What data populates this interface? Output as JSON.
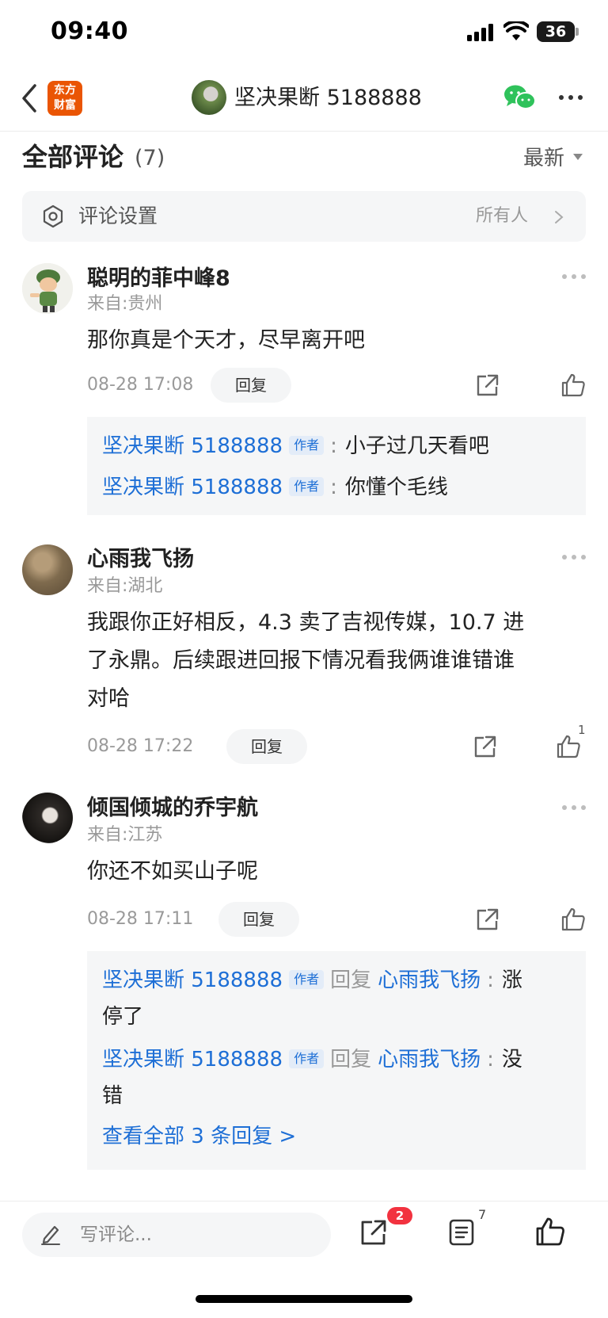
{
  "status": {
    "time": "09:40",
    "battery": "36"
  },
  "nav": {
    "logo_line1": "东方",
    "logo_line2": "财富",
    "title": "坚决果断 5188888"
  },
  "section": {
    "title": "全部评论",
    "count": "(7)",
    "sort": "最新"
  },
  "settings": {
    "label": "评论设置",
    "value": "所有人"
  },
  "comments": [
    {
      "name": "聪明的菲中峰8",
      "location": "来自:贵州",
      "text": "那你真是个天才，尽早离开吧",
      "time": "08-28 17:08",
      "reply_label": "回复",
      "replies": [
        {
          "author": "坚决果断 5188888",
          "tag": "作者",
          "text": "小子过几天看吧"
        },
        {
          "author": "坚决果断 5188888",
          "tag": "作者",
          "text": "你懂个毛线"
        }
      ]
    },
    {
      "name": "心雨我飞扬",
      "location": "来自:湖北",
      "text_lines": [
        "我跟你正好相反，4.3 卖了吉视传媒，10.7 进",
        "了永鼎。后续跟进回报下情况看我俩谁谁错谁",
        "对哈"
      ],
      "time": "08-28 17:22",
      "reply_label": "回复",
      "like_count": "1"
    },
    {
      "name": "倾国倾城的乔宇航",
      "location": "来自:江苏",
      "text": "你还不如买山子呢",
      "time": "08-28 17:11",
      "reply_label": "回复",
      "replies": [
        {
          "author": "坚决果断 5188888",
          "tag": "作者",
          "verb": "回复",
          "target": "心雨我飞扬",
          "text_a": "涨",
          "text_b": "停了"
        },
        {
          "author": "坚决果断 5188888",
          "tag": "作者",
          "verb": "回复",
          "target": "心雨我飞扬",
          "text_a": "没",
          "text_b": "错"
        }
      ],
      "view_all": "查看全部 3 条回复 >"
    }
  ],
  "bottom": {
    "compose_placeholder": "写评论...",
    "share_badge": "2",
    "comment_count": "7"
  }
}
